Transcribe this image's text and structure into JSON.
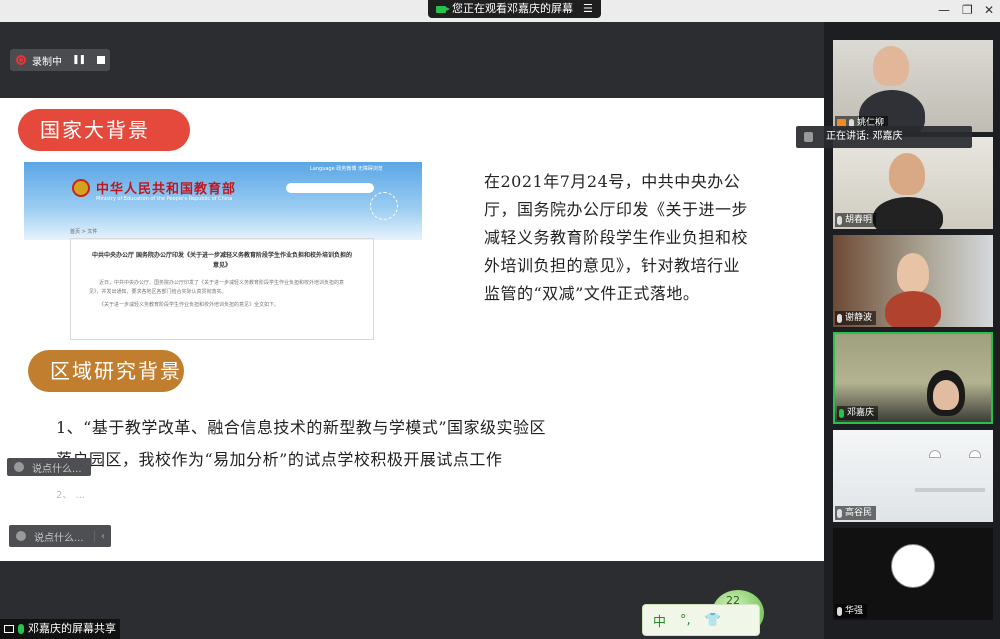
{
  "topbar": {
    "viewing_text": "您正在观看邓嘉庆的屏幕",
    "minimize": "—",
    "restore": "❐",
    "close": "✕"
  },
  "recording": {
    "label": "录制中",
    "pause": "❚❚"
  },
  "slide": {
    "section1_title": "国家大背景",
    "section2_title": "区域研究背景",
    "moe": {
      "site_title": "中华人民共和国教育部",
      "site_subtitle": "Ministry of Education of the People's Republic of China",
      "top_links": "Language   政务微博   无障碍浏览",
      "breadcrumb": "首页 > 文件",
      "doc_title": "中共中央办公厅 国务院办公厅印发《关于进一步减轻义务教育阶段学生作业负担和校外培训负担的意见》",
      "doc_body1": "近日，中共中央办公厅、国务院办公厅印发了《关于进一步减轻义务教育阶段学生作业负担和校外培训负担的意见》，并发出通知，要求各地区各部门结合实际认真贯彻落实。",
      "doc_body2": "《关于进一步减轻义务教育阶段学生作业负担和校外培训负担的意见》全文如下。"
    },
    "paragraph": "在2021年7月24号，中共中央办公厅，国务院办公厅印发《关于进一步减轻义务教育阶段学生作业负担和校外培训负担的意见》，针对教培行业监管的“双减”文件正式落地。",
    "point1_line1": "1、“基于教学改革、融合信息技术的新型教与学模式”国家级实验区",
    "point1_line2": "落户园区，我校作为“易加分析”的试点学校积极开展试点工作",
    "point2_partial": "2、 ..."
  },
  "chat": {
    "placeholder_small": "说点什么...",
    "placeholder_big": "说点什么...",
    "collapse_icon": "‹"
  },
  "share_label": "邓嘉庆的屏幕共享",
  "ime": {
    "mode": "中",
    "punct": "°,",
    "shirt": "👕",
    "count": "22"
  },
  "speaking": {
    "text": "正在讲话: 邓嘉庆"
  },
  "participants": [
    {
      "name": "姚仁柳"
    },
    {
      "name": "胡春明"
    },
    {
      "name": "谢静波"
    },
    {
      "name": "邓嘉庆"
    },
    {
      "name": "高谷民"
    },
    {
      "name": "华强"
    }
  ]
}
